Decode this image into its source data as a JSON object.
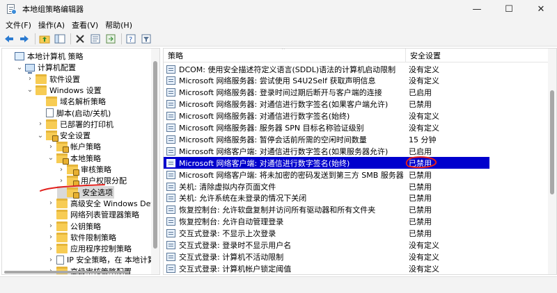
{
  "window": {
    "title": "本地组策略编辑器",
    "buttons": [
      "—",
      "☐",
      "✕"
    ]
  },
  "menu": [
    "文件(F)",
    "操作(A)",
    "查看(V)",
    "帮助(H)"
  ],
  "toolbar": {
    "icons": [
      "back-icon",
      "forward-icon",
      "up-folder-icon",
      "show-tree-icon",
      "delete-icon",
      "properties-icon",
      "export-icon",
      "help-icon",
      "filter-icon"
    ]
  },
  "tree": [
    {
      "label": "本地计算机 策略",
      "indent": 0,
      "icon": "policy",
      "toggle": ""
    },
    {
      "label": "计算机配置",
      "indent": 1,
      "icon": "computer",
      "toggle": "v"
    },
    {
      "label": "软件设置",
      "indent": 2,
      "icon": "folder",
      "toggle": ">"
    },
    {
      "label": "Windows 设置",
      "indent": 2,
      "icon": "folder",
      "toggle": "v"
    },
    {
      "label": "域名解析策略",
      "indent": 3,
      "icon": "folder",
      "toggle": ""
    },
    {
      "label": "脚本(启动/关机)",
      "indent": 3,
      "icon": "doc",
      "toggle": ""
    },
    {
      "label": "已部署的打印机",
      "indent": 3,
      "icon": "folder",
      "toggle": ">"
    },
    {
      "label": "安全设置",
      "indent": 3,
      "icon": "lockfolder",
      "toggle": "v"
    },
    {
      "label": "帐户策略",
      "indent": 4,
      "icon": "lockfolder",
      "toggle": ">"
    },
    {
      "label": "本地策略",
      "indent": 4,
      "icon": "lockfolder",
      "toggle": "v"
    },
    {
      "label": "审核策略",
      "indent": 5,
      "icon": "lockfolder",
      "toggle": ">"
    },
    {
      "label": "用户权限分配",
      "indent": 5,
      "icon": "lockfolder",
      "toggle": ">"
    },
    {
      "label": "安全选项",
      "indent": 5,
      "icon": "lockfolder",
      "toggle": "",
      "selected": true
    },
    {
      "label": "高级安全 Windows Defender",
      "indent": 4,
      "icon": "folder",
      "toggle": ">"
    },
    {
      "label": "网络列表管理器策略",
      "indent": 4,
      "icon": "folder",
      "toggle": ""
    },
    {
      "label": "公钥策略",
      "indent": 4,
      "icon": "folder",
      "toggle": ">"
    },
    {
      "label": "软件限制策略",
      "indent": 4,
      "icon": "folder",
      "toggle": ">"
    },
    {
      "label": "应用程序控制策略",
      "indent": 4,
      "icon": "folder",
      "toggle": ">"
    },
    {
      "label": "IP 安全策略，在 本地计算机",
      "indent": 4,
      "icon": "doc",
      "toggle": ">"
    },
    {
      "label": "高级审核策略配置",
      "indent": 4,
      "icon": "folder",
      "toggle": ">"
    }
  ],
  "list": {
    "col_policy": "策略",
    "col_setting": "安全设置",
    "rows": [
      {
        "name": "DCOM: 使用安全描述符定义语言(SDDL)语法的计算机启动限制",
        "value": "没有定义"
      },
      {
        "name": "Microsoft 网络服务器: 尝试使用 S4U2Self 获取声明信息",
        "value": "没有定义"
      },
      {
        "name": "Microsoft 网络服务器: 登录时间过期后断开与客户端的连接",
        "value": "已启用"
      },
      {
        "name": "Microsoft 网络服务器: 对通信进行数字签名(如果客户端允许)",
        "value": "已禁用"
      },
      {
        "name": "Microsoft 网络服务器: 对通信进行数字签名(始终)",
        "value": "没有定义"
      },
      {
        "name": "Microsoft 网络服务器: 服务器 SPN 目标名称验证级别",
        "value": "没有定义"
      },
      {
        "name": "Microsoft 网络服务器: 暂停会话前所需的空闲时间数量",
        "value": "15 分钟"
      },
      {
        "name": "Microsoft 网络客户端: 对通信进行数字签名(如果服务器允许)",
        "value": "已启用"
      },
      {
        "name": "Microsoft 网络客户端: 对通信进行数字签名(始终)",
        "value": "已禁用",
        "selected": true
      },
      {
        "name": "Microsoft 网络客户端: 将未加密的密码发送到第三方 SMB 服务器",
        "value": "已禁用"
      },
      {
        "name": "关机: 清除虚拟内存页面文件",
        "value": "已禁用"
      },
      {
        "name": "关机: 允许系统在未登录的情况下关闭",
        "value": "已禁用"
      },
      {
        "name": "恢复控制台: 允许软盘复制并访问所有驱动器和所有文件夹",
        "value": "已禁用"
      },
      {
        "name": "恢复控制台: 允许自动管理登录",
        "value": "已禁用"
      },
      {
        "name": "交互式登录: 不显示上次登录",
        "value": "已禁用"
      },
      {
        "name": "交互式登录: 登录时不显示用户名",
        "value": "没有定义"
      },
      {
        "name": "交互式登录: 计算机不活动限制",
        "value": "没有定义"
      },
      {
        "name": "交互式登录: 计算机帐户锁定阈值",
        "value": "没有定义"
      },
      {
        "name": "交互式登录: 试图登录的用户的消息标题",
        "value": ""
      }
    ]
  },
  "colors": {
    "selection": "#0000cd",
    "annotation": "#e2201c",
    "chrome": "#f3f3f3"
  }
}
